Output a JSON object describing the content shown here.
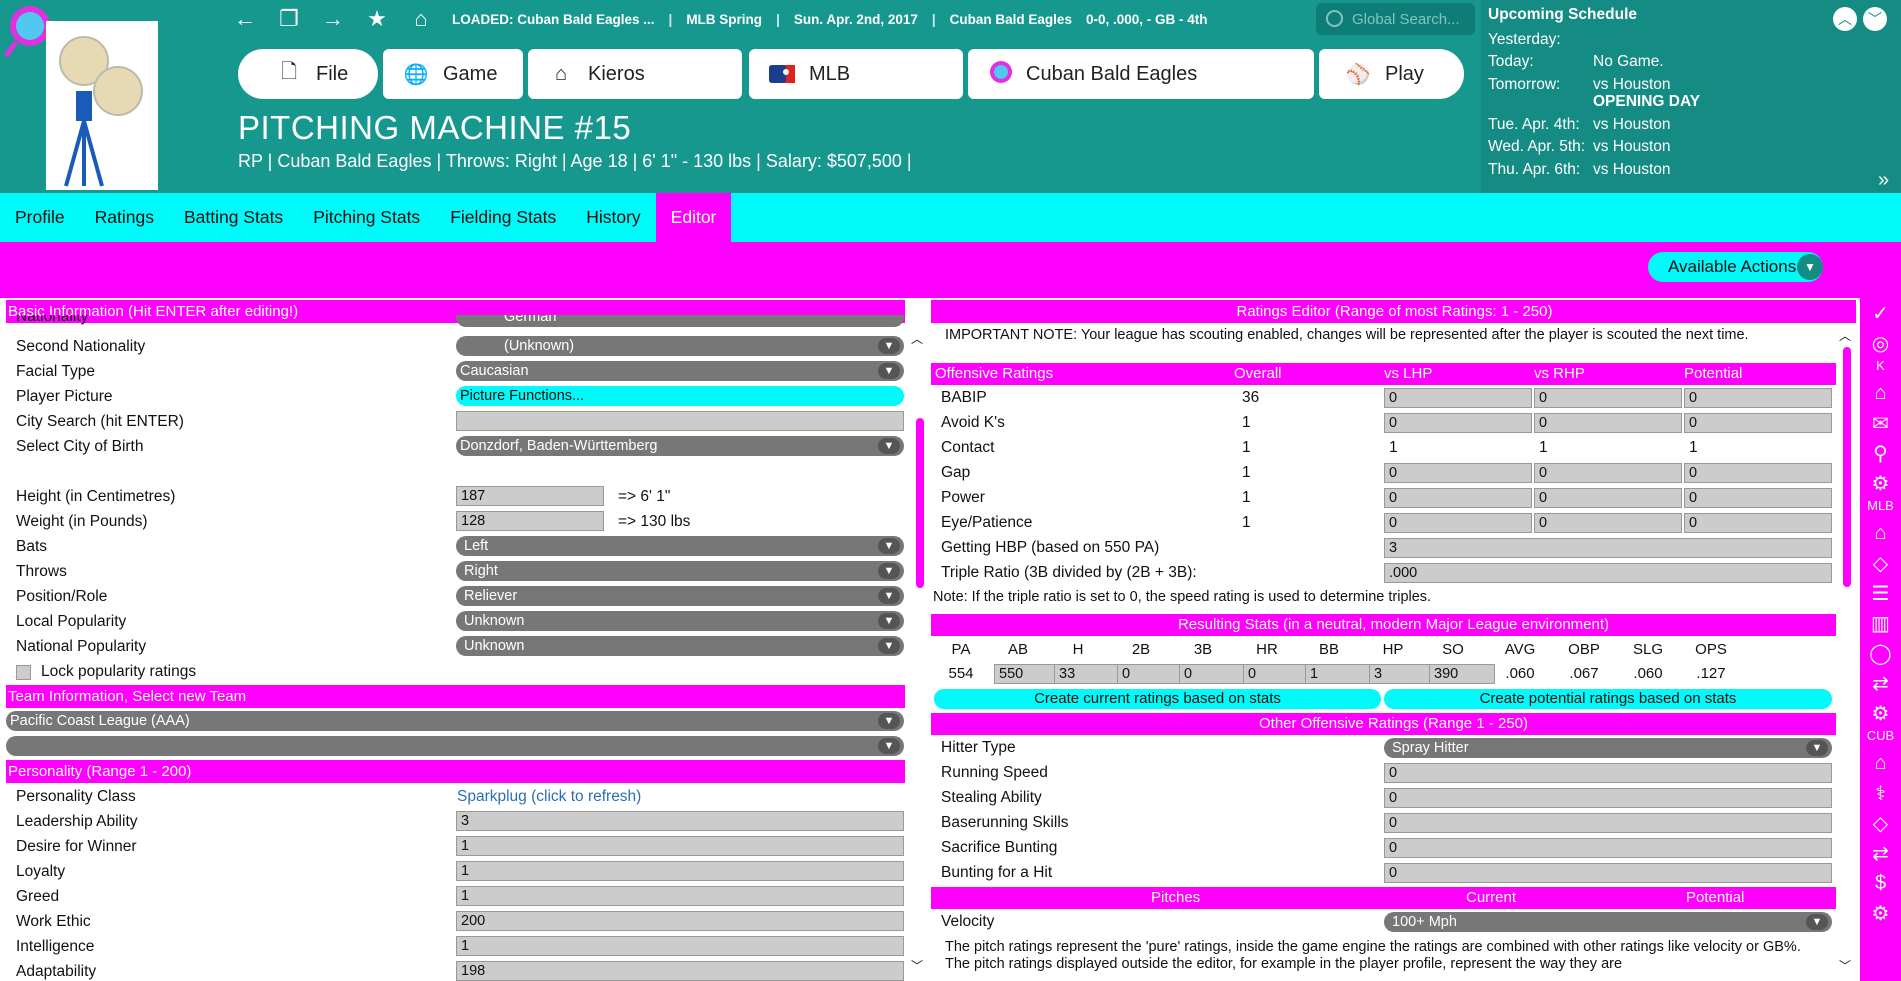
{
  "topbar": {
    "loaded": "LOADED: Cuban Bald Eagles ...",
    "league": "MLB Spring",
    "date": "Sun. Apr. 2nd, 2017",
    "team": "Cuban Bald Eagles",
    "record": "0-0, .000, - GB - 4th",
    "search_placeholder": "Global Search..."
  },
  "nav": {
    "file": "File",
    "game": "Game",
    "kieros": "Kieros",
    "mlb": "MLB",
    "team": "Cuban Bald Eagles",
    "play": "Play"
  },
  "player": {
    "name": "PITCHING MACHINE  #15",
    "info": "RP | Cuban Bald Eagles  |  Throws: Right  |  Age 18  |  6' 1\" - 130 lbs  |  Salary: $507,500  |"
  },
  "schedule": {
    "title": "Upcoming Schedule",
    "rows": [
      {
        "label": "Yesterday:",
        "value": ""
      },
      {
        "label": "Today:",
        "value": "No Game."
      },
      {
        "label": "Tomorrow:",
        "value": "vs Houston"
      },
      {
        "label": "",
        "value": "OPENING DAY"
      },
      {
        "label": "Tue. Apr. 4th:",
        "value": "vs Houston"
      },
      {
        "label": "Wed. Apr. 5th:",
        "value": "vs Houston"
      },
      {
        "label": "Thu. Apr. 6th:",
        "value": "vs Houston"
      }
    ]
  },
  "tabs": [
    "Profile",
    "Ratings",
    "Batting Stats",
    "Pitching Stats",
    "Fielding Stats",
    "History",
    "Editor"
  ],
  "actions": "Available Actions",
  "rightbar": {
    "k": "K",
    "mlb": "MLB",
    "cub": "CUB"
  },
  "left": {
    "basic_header": "Basic Information (Hit ENTER after editing!)",
    "nationality_label": "Nationality",
    "nationality_value": "German",
    "second_nat_label": "Second Nationality",
    "second_nat_value": "(Unknown)",
    "facial_label": "Facial Type",
    "facial_value": "Caucasian",
    "picture_label": "Player Picture",
    "picture_value": "Picture Functions...",
    "city_search_label": "City Search (hit ENTER)",
    "city_birth_label": "Select City of Birth",
    "city_birth_value": "Donzdorf, Baden-Württemberg",
    "height_label": "Height (in Centimetres)",
    "height_value": "187",
    "height_conv": "=> 6' 1\"",
    "weight_label": "Weight (in Pounds)",
    "weight_value": "128",
    "weight_conv": "=> 130 lbs",
    "bats_label": "Bats",
    "bats_value": "Left",
    "throws_label": "Throws",
    "throws_value": "Right",
    "position_label": "Position/Role",
    "position_value": "Reliever",
    "local_pop_label": "Local Popularity",
    "local_pop_value": "Unknown",
    "national_pop_label": "National Popularity",
    "national_pop_value": "Unknown",
    "lock_label": "Lock popularity ratings",
    "team_header": "Team Information, Select new Team",
    "team_league": "Pacific Coast League (AAA)",
    "team_team": "",
    "personality_header": "Personality (Range 1 - 200)",
    "pclass_label": "Personality Class",
    "pclass_value": "Sparkplug (click to refresh)",
    "leadership_label": "Leadership Ability",
    "leadership_value": "3",
    "desire_label": "Desire for Winner",
    "desire_value": "1",
    "loyalty_label": "Loyalty",
    "loyalty_value": "1",
    "greed_label": "Greed",
    "greed_value": "1",
    "work_label": "Work Ethic",
    "work_value": "200",
    "intel_label": "Intelligence",
    "intel_value": "1",
    "adapt_label": "Adaptability",
    "adapt_value": "198"
  },
  "right": {
    "header": "Ratings Editor (Range of most Ratings: 1 - 250)",
    "note": "IMPORTANT NOTE: Your league has scouting enabled, changes will be represented after the player is scouted the next time.",
    "off_header": {
      "name": "Offensive Ratings",
      "overall": "Overall",
      "vslhp": "vs LHP",
      "vsrhp": "vs RHP",
      "potential": "Potential"
    },
    "ratings": [
      {
        "name": "BABIP",
        "overall": "36",
        "lhp": "0",
        "rhp": "0",
        "pot": "0"
      },
      {
        "name": "Avoid K's",
        "overall": "1",
        "lhp": "0",
        "rhp": "0",
        "pot": "0"
      },
      {
        "name": "Contact",
        "overall": "1",
        "lhp": "1",
        "rhp": "1",
        "pot": "1"
      },
      {
        "name": "Gap",
        "overall": "1",
        "lhp": "0",
        "rhp": "0",
        "pot": "0"
      },
      {
        "name": "Power",
        "overall": "1",
        "lhp": "0",
        "rhp": "0",
        "pot": "0"
      },
      {
        "name": "Eye/Patience",
        "overall": "1",
        "lhp": "0",
        "rhp": "0",
        "pot": "0"
      }
    ],
    "hbp_label": "Getting HBP (based on 550 PA)",
    "hbp_value": "3",
    "triple_label": "Triple Ratio (3B divided by (2B + 3B):",
    "triple_value": ".000",
    "triple_note": "Note: If the triple ratio is set to 0, the speed rating is used to determine triples.",
    "result_header": "Resulting Stats (in a neutral, modern Major League environment)",
    "stat_cols": [
      "PA",
      "AB",
      "H",
      "2B",
      "3B",
      "HR",
      "BB",
      "HP",
      "SO",
      "AVG",
      "OBP",
      "SLG",
      "OPS"
    ],
    "stat_vals": [
      "554",
      "550",
      "33",
      "0",
      "0",
      "0",
      "1",
      "3",
      "390",
      ".060",
      ".067",
      ".060",
      ".127"
    ],
    "btn_current": "Create current ratings based on stats",
    "btn_potential": "Create potential ratings based on stats",
    "other_header": "Other Offensive Ratings (Range 1 - 250)",
    "hitter_label": "Hitter Type",
    "hitter_value": "Spray Hitter",
    "speed_label": "Running Speed",
    "speed_value": "0",
    "steal_label": "Stealing Ability",
    "steal_value": "0",
    "baserun_label": "Baserunning Skills",
    "baserun_value": "0",
    "sacbunt_label": "Sacrifice Bunting",
    "sacbunt_value": "0",
    "bunthit_label": "Bunting for a Hit",
    "bunthit_value": "0",
    "pitch_header": {
      "name": "Pitches",
      "current": "Current",
      "potential": "Potential"
    },
    "velocity_label": "Velocity",
    "velocity_value": "100+ Mph",
    "pitch_note": "The pitch ratings represent the 'pure' ratings, inside the game engine the ratings are combined with other ratings like velocity or GB%. The pitch ratings displayed outside the editor, for example in the player profile, represent the way they are"
  }
}
